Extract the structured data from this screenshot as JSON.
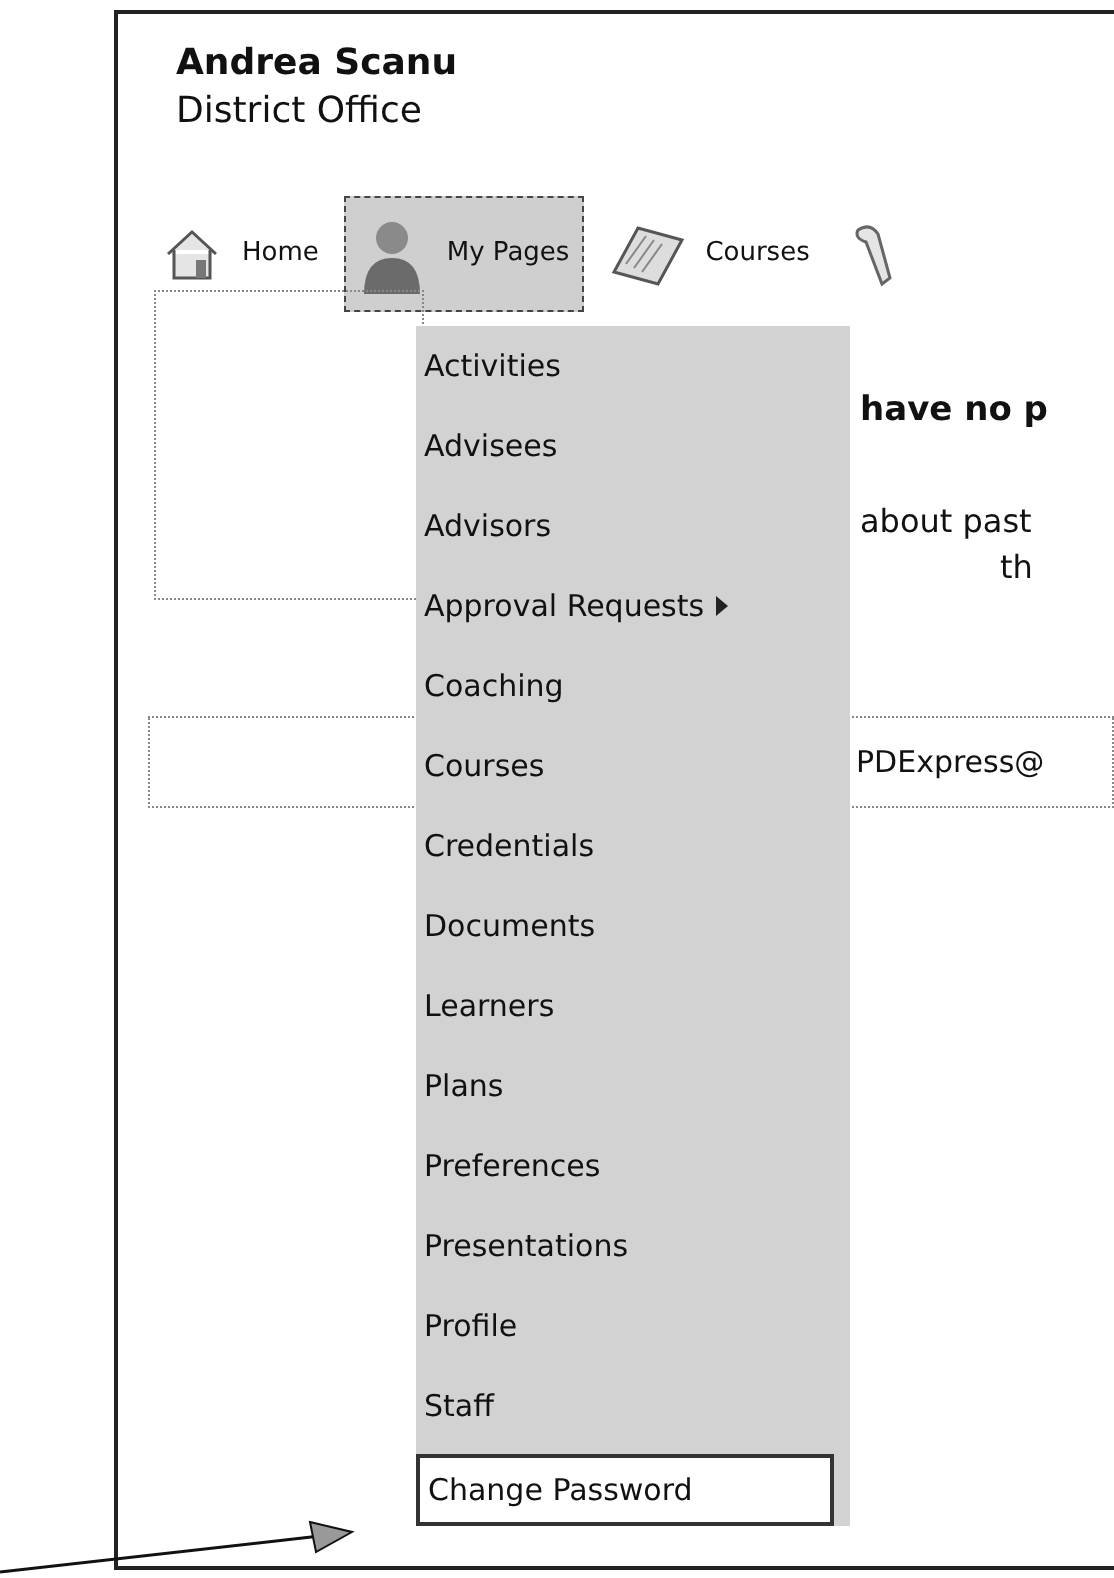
{
  "header": {
    "name": "Andrea Scanu",
    "office": "District Office"
  },
  "nav": [
    {
      "label": "Home",
      "selected": false
    },
    {
      "label": "My Pages",
      "selected": true
    },
    {
      "label": "Courses",
      "selected": false
    },
    {
      "selected": false
    }
  ],
  "menu": [
    {
      "label": "Activities",
      "submenu": false,
      "selected": false
    },
    {
      "label": "Advisees",
      "submenu": false,
      "selected": false
    },
    {
      "label": "Advisors",
      "submenu": false,
      "selected": false
    },
    {
      "label": "Approval Requests",
      "submenu": true,
      "selected": false
    },
    {
      "label": "Coaching",
      "submenu": false,
      "selected": false
    },
    {
      "label": "Courses",
      "submenu": false,
      "selected": false
    },
    {
      "label": "Credentials",
      "submenu": false,
      "selected": false
    },
    {
      "label": "Documents",
      "submenu": false,
      "selected": false
    },
    {
      "label": "Learners",
      "submenu": false,
      "selected": false
    },
    {
      "label": "Plans",
      "submenu": false,
      "selected": false
    },
    {
      "label": "Preferences",
      "submenu": false,
      "selected": false
    },
    {
      "label": "Presentations",
      "submenu": false,
      "selected": false
    },
    {
      "label": "Profile",
      "submenu": false,
      "selected": false
    },
    {
      "label": "Staff",
      "submenu": false,
      "selected": false
    },
    {
      "label": "Change Password",
      "submenu": false,
      "selected": true
    }
  ],
  "content": {
    "heading": "have no p",
    "lines": [
      "about past",
      "th"
    ],
    "footer": "PDExpress@"
  }
}
